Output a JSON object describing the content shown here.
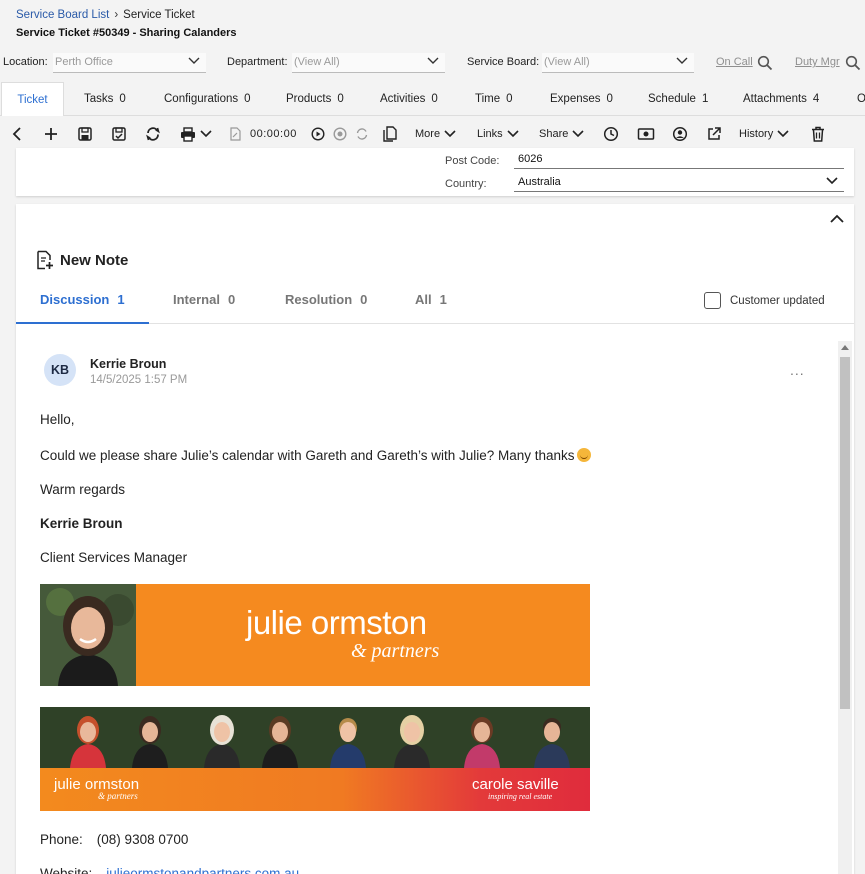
{
  "breadcrumb": {
    "parent": "Service Board List",
    "current": "Service Ticket"
  },
  "title": "Service Ticket #50349 - Sharing Calanders",
  "filters": {
    "location_label": "Location:",
    "location_value": "Perth Office",
    "department_label": "Department:",
    "department_value": "(View All)",
    "board_label": "Service Board:",
    "board_value": "(View All)",
    "on_call": "On Call",
    "duty_mgr": "Duty Mgr"
  },
  "tabs": [
    {
      "label": "Ticket",
      "count": ""
    },
    {
      "label": "Tasks",
      "count": "0"
    },
    {
      "label": "Configurations",
      "count": "0"
    },
    {
      "label": "Products",
      "count": "0"
    },
    {
      "label": "Activities",
      "count": "0"
    },
    {
      "label": "Time",
      "count": "0"
    },
    {
      "label": "Expenses",
      "count": "0"
    },
    {
      "label": "Schedule",
      "count": "1"
    },
    {
      "label": "Attachments",
      "count": "4"
    },
    {
      "label": "O",
      "count": ""
    }
  ],
  "toolbar": {
    "timer": "00:00:00",
    "more": "More",
    "links": "Links",
    "share": "Share",
    "history": "History"
  },
  "address": {
    "postcode_label": "Post Code:",
    "postcode_value": "6026",
    "country_label": "Country:",
    "country_value": "Australia"
  },
  "notes": {
    "new_note": "New Note",
    "tabs": [
      {
        "label": "Discussion",
        "count": "1"
      },
      {
        "label": "Internal",
        "count": "0"
      },
      {
        "label": "Resolution",
        "count": "0"
      },
      {
        "label": "All",
        "count": "1"
      }
    ],
    "customer_updated": "Customer updated"
  },
  "note": {
    "initials": "KB",
    "author": "Kerrie Broun",
    "time": "14/5/2025 1:57 PM",
    "more": "...",
    "greeting": "Hello,",
    "body": "Could we please share Julie’s calendar with Gareth and Gareth’s with Julie? Many thanks",
    "signoff": "Warm regards",
    "sig_name": "Kerrie Broun",
    "sig_title": "Client Services Manager",
    "banner1_name": "julie ormston",
    "banner1_sub": "& partners",
    "banner2_name": "julie ormston",
    "banner2_sub": "& partners",
    "banner2_name2": "carole saville",
    "banner2_sub2": "inspiring real estate",
    "phone_label": "Phone:",
    "phone_value": "(08) 9308 0700",
    "website_label": "Website:",
    "website_value": "julieormstonandpartners.com.au"
  },
  "colors": {
    "accent": "#2d6fd1",
    "banner_orange": "#f58a1f",
    "banner_red": "#e02c3c"
  }
}
